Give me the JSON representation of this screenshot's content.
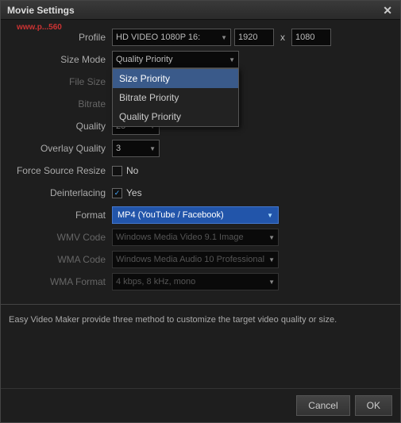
{
  "window": {
    "title": "Movie Settings",
    "close_label": "✕"
  },
  "watermark": "www.p...560",
  "form": {
    "profile_label": "Profile",
    "profile_value": "HD VIDEO 1080P 16:",
    "resolution_w": "1920",
    "resolution_h": "1080",
    "size_mode_label": "Size Mode",
    "size_mode_value": "Quality Priority",
    "file_size_label": "File Size",
    "bitrate_label": "Bitrate",
    "quality_label": "Quality",
    "quality_value": "25",
    "overlay_quality_label": "Overlay Quality",
    "overlay_quality_value": "3",
    "force_source_label": "Force Source Resize",
    "force_source_value": "No",
    "deinterlacing_label": "Deinterlacing",
    "deinterlacing_value": "Yes",
    "format_label": "Format",
    "format_value": "MP4 (YouTube / Facebook)",
    "wmv_code_label": "WMV Code",
    "wmv_code_value": "Windows Media Video 9.1 Image",
    "wma_code_label": "WMA Code",
    "wma_code_value": "Windows Media Audio 10 Professional",
    "wma_format_label": "WMA Format",
    "wma_format_value": "4 kbps, 8 kHz, mono"
  },
  "dropdown": {
    "items": [
      {
        "label": "Size Priority",
        "highlighted": true
      },
      {
        "label": "Bitrate Priority",
        "highlighted": false
      },
      {
        "label": "Quality Priority",
        "highlighted": false
      }
    ]
  },
  "footer": {
    "text": "Easy Video Maker provide three method to customize the target video quality or size."
  },
  "buttons": {
    "cancel": "Cancel",
    "ok": "OK"
  }
}
